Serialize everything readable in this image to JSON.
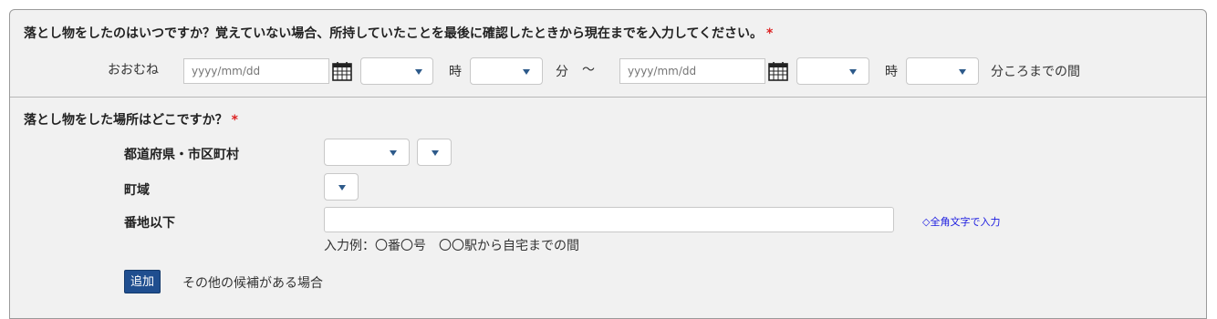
{
  "q1": {
    "title": "落とし物をしたのはいつですか？覚えていない場合、所持していたことを最後に確認したときから現在までを入力してください。",
    "required_mark": "*",
    "prefix": "おおむね",
    "date_placeholder": "yyyy/mm/dd",
    "hour_label": "時",
    "minute_label": "分",
    "range_sep": "〜",
    "suffix": "分ころまでの間"
  },
  "q2": {
    "title": "落とし物をした場所はどこですか？",
    "required_mark": "*",
    "prefecture_city_label": "都道府県・市区町村",
    "town_label": "町域",
    "address_label": "番地以下",
    "address_hint": "◇全角文字で入力",
    "address_example": "入力例：〇番〇号　〇〇駅から自宅までの間",
    "add_button": "追加",
    "add_note": "その他の候補がある場合"
  },
  "colors": {
    "required": "#dd2222",
    "button_bg": "#1f4e8f",
    "hint_link": "#1a1ae0",
    "panel_bg": "#f1f1f1"
  },
  "icons": [
    "calendar-icon",
    "chevron-down-icon"
  ]
}
